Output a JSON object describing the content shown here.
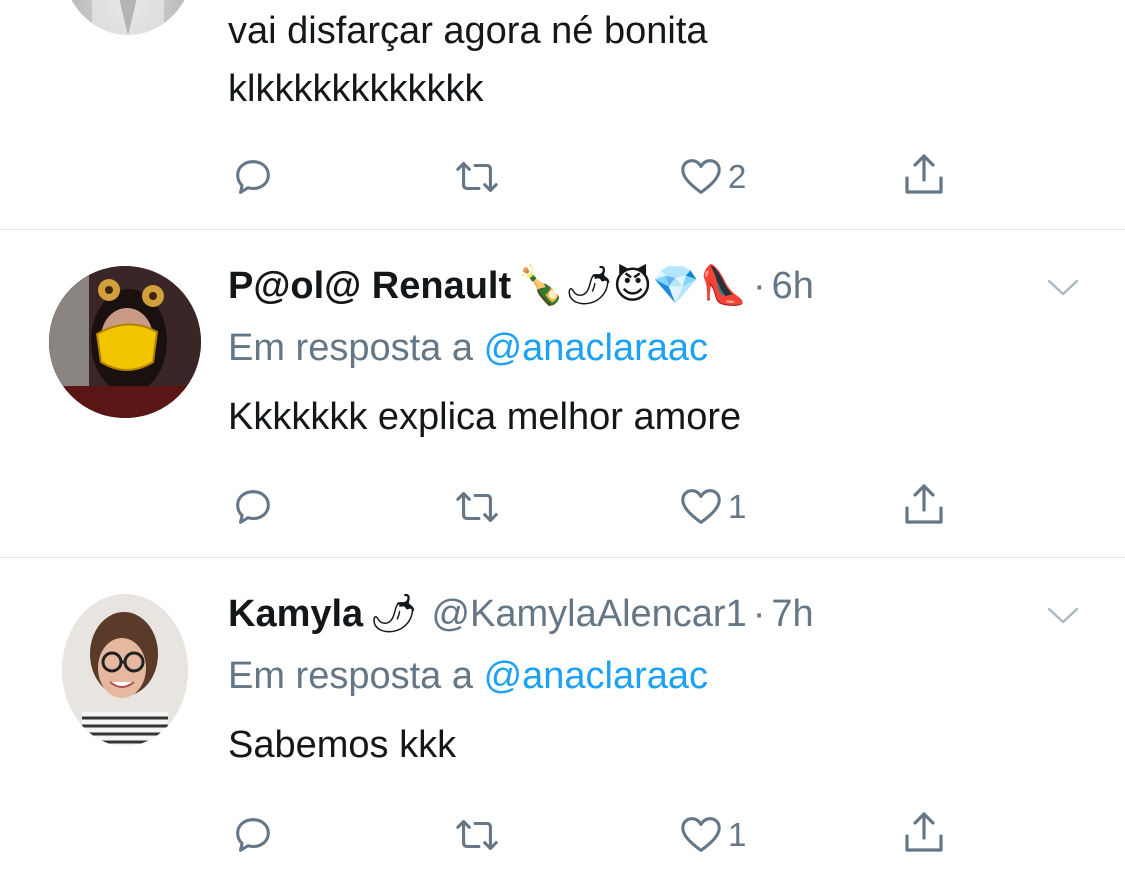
{
  "colors": {
    "text": "#14171a",
    "muted": "#657786",
    "link": "#1da1f2",
    "divider": "#e1e8ed"
  },
  "tweets": [
    {
      "display_name": "",
      "handle": "",
      "time": "",
      "body_lines": [
        "vai disfarçar agora né bonita",
        "klkkkkkkkkkkkk"
      ],
      "actions": {
        "reply_count": "",
        "retweet_count": "",
        "like_count": "2"
      }
    },
    {
      "display_name": "P@ol@ Renault",
      "name_emojis": "🍾🌶😈💎👠",
      "handle": "",
      "dot": "·",
      "time": "6h",
      "reply_prefix": "Em resposta a",
      "reply_to": "@anaclaraac",
      "body_lines": [
        "Kkkkkkk explica melhor amore"
      ],
      "actions": {
        "reply_count": "",
        "retweet_count": "",
        "like_count": "1"
      }
    },
    {
      "display_name": "Kamyla",
      "name_emojis": "🌶",
      "handle": "@KamylaAlencar1",
      "dot": "·",
      "time": "7h",
      "reply_prefix": "Em resposta a",
      "reply_to": "@anaclaraac",
      "body_lines": [
        "Sabemos kkk"
      ],
      "actions": {
        "reply_count": "",
        "retweet_count": "",
        "like_count": "1"
      }
    }
  ]
}
